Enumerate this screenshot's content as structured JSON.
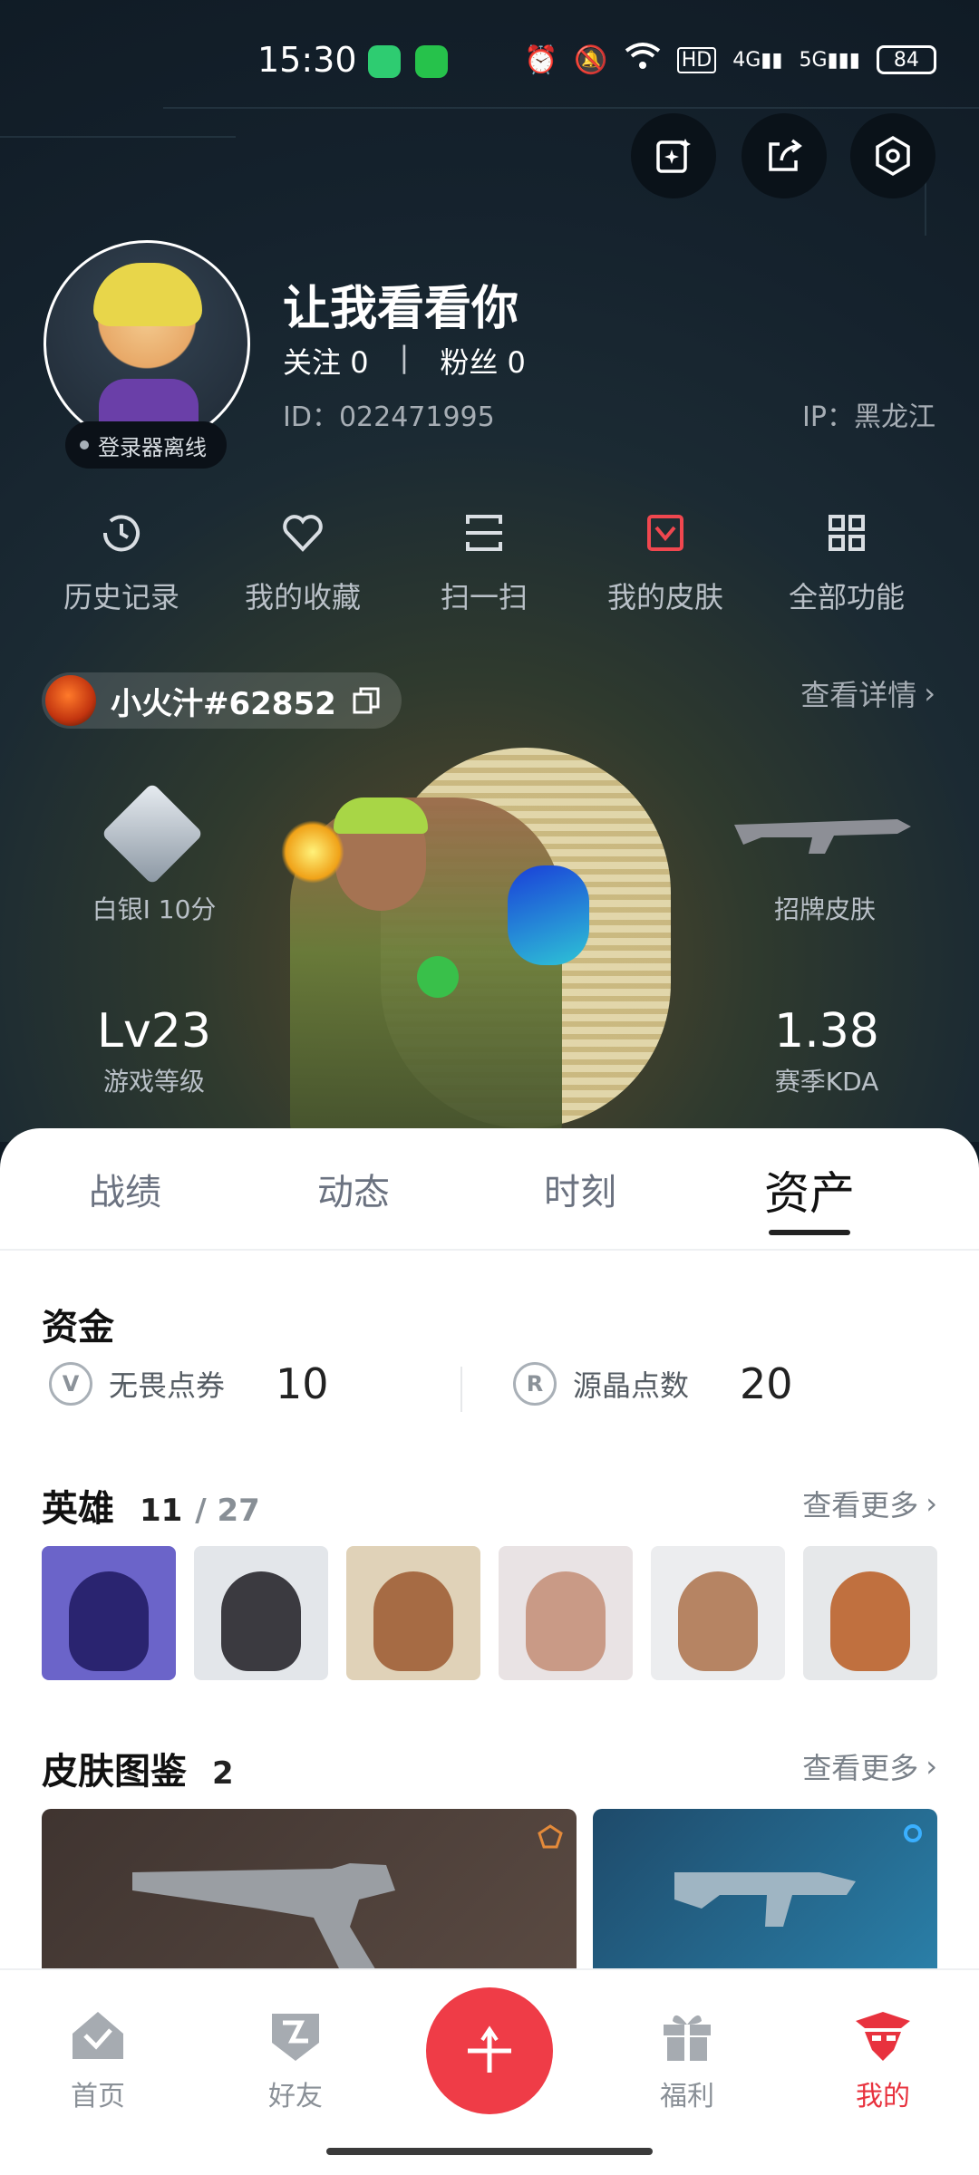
{
  "status_bar": {
    "time": "15:30",
    "battery": "84"
  },
  "profile": {
    "name": "让我看看你",
    "follow_label": "关注",
    "follow_count": "0",
    "fans_label": "粉丝",
    "fans_count": "0",
    "id_text": "ID：022471995",
    "ip_text": "IP：黑龙江",
    "status": "登录器离线"
  },
  "quick_menu": [
    {
      "label": "历史记录",
      "icon": "history-icon"
    },
    {
      "label": "我的收藏",
      "icon": "heart-icon"
    },
    {
      "label": "扫一扫",
      "icon": "scan-icon"
    },
    {
      "label": "我的皮肤",
      "icon": "skin-icon"
    },
    {
      "label": "全部功能",
      "icon": "grid-icon"
    }
  ],
  "player": {
    "tag": "小火汁#62852",
    "view_detail": "查看详情"
  },
  "game_stats": {
    "rank": "白银I 10分",
    "signature_skin": "招牌皮肤",
    "level_value": "Lv23",
    "level_label": "游戏等级",
    "kda_value": "1.38",
    "kda_label": "赛季KDA"
  },
  "tabs": [
    "战绩",
    "动态",
    "时刻",
    "资产"
  ],
  "active_tab": "资产",
  "funds": {
    "title": "资金",
    "items": [
      {
        "label": "无畏点券",
        "value": "10"
      },
      {
        "label": "源晶点数",
        "value": "20"
      }
    ]
  },
  "heroes": {
    "title": "英雄",
    "owned": "11",
    "total": "/ 27",
    "more": "查看更多"
  },
  "skins": {
    "title": "皮肤图鉴",
    "count": "2",
    "more": "查看更多"
  },
  "bottom_nav": [
    {
      "label": "首页",
      "icon": "home-icon"
    },
    {
      "label": "好友",
      "icon": "friends-icon"
    },
    {
      "label": "福利",
      "icon": "gift-icon"
    },
    {
      "label": "我的",
      "icon": "me-icon"
    }
  ],
  "colors": {
    "accent": "#ef3c47",
    "active_nav": "#e8323e"
  }
}
